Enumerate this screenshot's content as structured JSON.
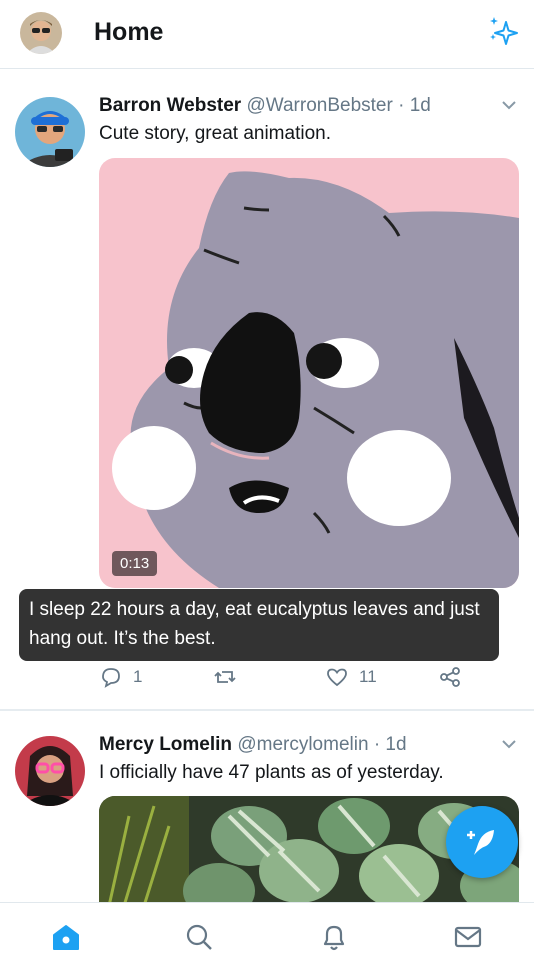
{
  "header": {
    "title": "Home",
    "avatar_icon": "user-avatar",
    "sparkle_icon": "sparkle-icon"
  },
  "tweets": [
    {
      "name": "Barron Webster",
      "handle": "@WarronBebster",
      "time": "· 1d",
      "text": "Cute story, great animation.",
      "video_duration": "0:13",
      "caption": "I sleep 22 hours a day, eat eucalyptus leaves and just hang out. It’s the best.",
      "replies": "1",
      "likes": "11"
    },
    {
      "name": "Mercy Lomelin",
      "handle": "@mercylomelin",
      "time": "· 1d",
      "text": "I officially have 47 plants as of yesterday."
    }
  ],
  "colors": {
    "accent": "#1da1f2",
    "koala_bg": "#f7c3cc",
    "koala_body": "#9c97ac"
  },
  "bottom_nav": [
    "home-icon",
    "search-icon",
    "bell-icon",
    "mail-icon"
  ]
}
